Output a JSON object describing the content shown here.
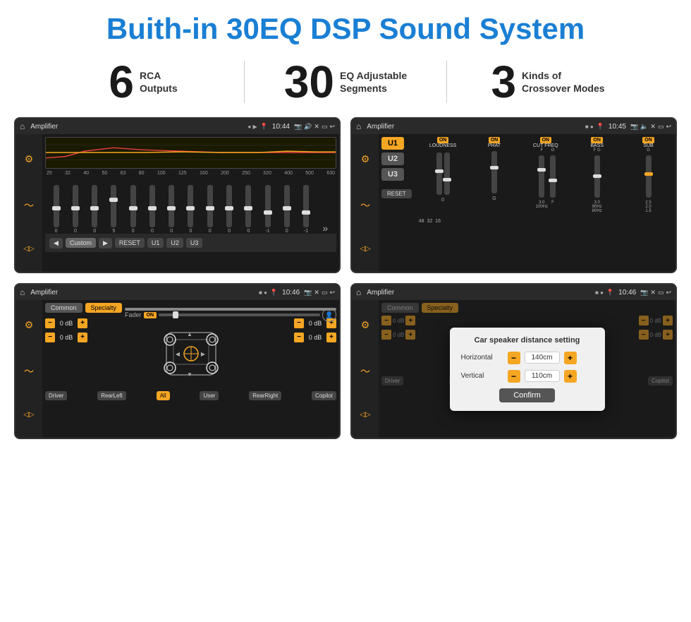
{
  "page": {
    "title": "Buith-in 30EQ DSP Sound System"
  },
  "stats": [
    {
      "number": "6",
      "label_line1": "RCA",
      "label_line2": "Outputs"
    },
    {
      "number": "30",
      "label_line1": "EQ Adjustable",
      "label_line2": "Segments"
    },
    {
      "number": "3",
      "label_line1": "Kinds of",
      "label_line2": "Crossover Modes"
    }
  ],
  "screens": [
    {
      "id": "eq-screen",
      "status_bar": {
        "title": "Amplifier",
        "time": "10:44"
      }
    },
    {
      "id": "crossover-screen",
      "status_bar": {
        "title": "Amplifier",
        "time": "10:45"
      }
    },
    {
      "id": "speaker-screen",
      "status_bar": {
        "title": "Amplifier",
        "time": "10:46"
      }
    },
    {
      "id": "distance-screen",
      "status_bar": {
        "title": "Amplifier",
        "time": "10:46"
      },
      "dialog": {
        "title": "Car speaker distance setting",
        "horizontal_label": "Horizontal",
        "horizontal_value": "140cm",
        "vertical_label": "Vertical",
        "vertical_value": "110cm",
        "confirm_label": "Confirm"
      }
    }
  ],
  "eq": {
    "frequencies": [
      "25",
      "32",
      "40",
      "50",
      "63",
      "80",
      "100",
      "125",
      "160",
      "200",
      "250",
      "320",
      "400",
      "500",
      "630"
    ],
    "values": [
      "0",
      "0",
      "0",
      "5",
      "0",
      "0",
      "0",
      "0",
      "0",
      "0",
      "0",
      "-1",
      "0",
      "-1"
    ],
    "presets": [
      "Custom",
      "RESET",
      "U1",
      "U2",
      "U3"
    ]
  },
  "crossover": {
    "u_buttons": [
      "U1",
      "U2",
      "U3"
    ],
    "channels": [
      "LOUDNESS",
      "PHAT",
      "CUT FREQ",
      "BASS",
      "SUB"
    ],
    "reset_label": "RESET"
  },
  "speaker": {
    "tabs": [
      "Common",
      "Specialty"
    ],
    "fader_label": "Fader",
    "db_values": [
      "0 dB",
      "0 dB",
      "0 dB",
      "0 dB"
    ],
    "bottom_buttons": [
      "Driver",
      "RearLeft",
      "All",
      "User",
      "RearRight",
      "Copilot"
    ]
  }
}
